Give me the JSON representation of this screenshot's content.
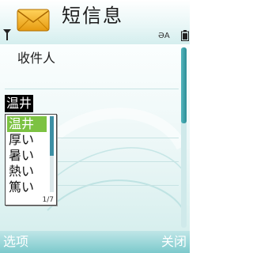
{
  "status_bar": {
    "app_title": "短信息",
    "input_mode": "ƏA",
    "icons": [
      "messaging-envelope-icon",
      "signal-icon",
      "battery-icon"
    ]
  },
  "editor": {
    "recipient_label": "收件人",
    "recipient_value": "温井"
  },
  "candidate_popup": {
    "items": [
      "温井",
      "厚い",
      "暑い",
      "熱い",
      "篤い"
    ],
    "selected_index": 0,
    "page_indicator": "1/7"
  },
  "softkeys": {
    "left": "选项",
    "right": "关闭"
  },
  "colors": {
    "selection": "#7cc242",
    "softkey_bar": "#7cc9cc",
    "scroll_thumb": "#2b8d96"
  }
}
